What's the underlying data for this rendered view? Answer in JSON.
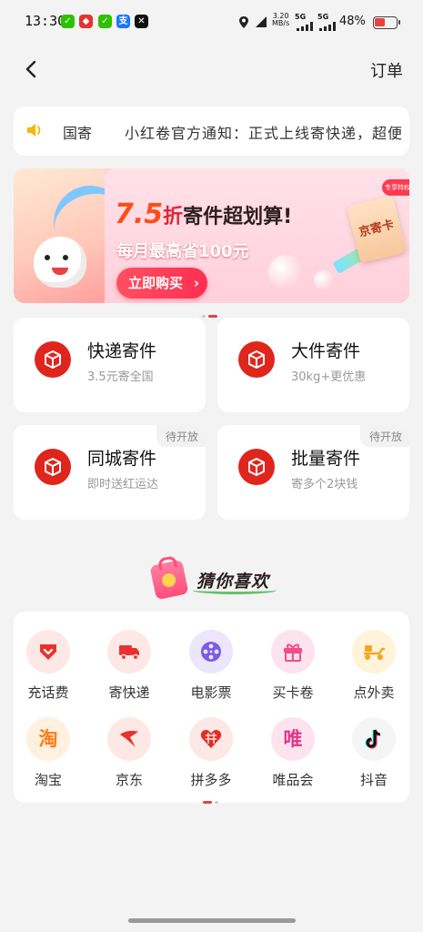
{
  "status_bar": {
    "time": "13:30",
    "speed_value": "3.20",
    "speed_unit": "MB/s",
    "net1": "5G",
    "net2": "5G",
    "battery": "48%",
    "battery_level": 0.48,
    "app_icons": [
      "wechat-icon",
      "app-red-icon",
      "wechat-icon",
      "alipay-icon",
      "capcut-icon"
    ]
  },
  "nav": {
    "back_icon": "chevron-left-icon",
    "orders_label": "订单"
  },
  "notice": {
    "icon": "speaker-icon",
    "tag": "国寄",
    "text": "小红卷官方通知：正式上线寄快递，超便"
  },
  "banner": {
    "discount": "7.5",
    "discount_unit": "折",
    "headline": "寄件超划算!",
    "subline": "每月最高省100元",
    "cta_label": "立即购买",
    "card_label": "京寄卡",
    "badge": "专享特权",
    "active_page": 1,
    "page_count": 2
  },
  "services": [
    {
      "title": "快递寄件",
      "subtitle": "3.5元寄全国",
      "badge": ""
    },
    {
      "title": "大件寄件",
      "subtitle": "30kg+更优惠",
      "badge": ""
    },
    {
      "title": "同城寄件",
      "subtitle": "即时送红运达",
      "badge": "待开放"
    },
    {
      "title": "批量寄件",
      "subtitle": "寄多个2块钱",
      "badge": "待开放"
    }
  ],
  "guess_section": {
    "title": "猜你喜欢"
  },
  "apps": [
    {
      "label": "充话费",
      "icon": "heart-tag-icon",
      "bg": "#fde8e6",
      "color": "#e8322f"
    },
    {
      "label": "寄快递",
      "icon": "truck-icon",
      "bg": "#fde8e6",
      "color": "#e8322f"
    },
    {
      "label": "电影票",
      "icon": "film-reel-icon",
      "bg": "#ebe6fb",
      "color": "#7a5ce6"
    },
    {
      "label": "买卡卷",
      "icon": "gift-icon",
      "bg": "#fde3ee",
      "color": "#ef4e8a"
    },
    {
      "label": "点外卖",
      "icon": "scooter-icon",
      "bg": "#fff3d9",
      "color": "#f5a623"
    },
    {
      "label": "淘宝",
      "icon": "taobao-icon",
      "glyph": "淘",
      "bg": "#fff0df",
      "color": "#ff7a1a"
    },
    {
      "label": "京东",
      "icon": "jd-icon",
      "bg": "#fde8e6",
      "color": "#e8322f"
    },
    {
      "label": "拼多多",
      "icon": "pinduoduo-icon",
      "bg": "#fde8e6",
      "color": "#e02e24"
    },
    {
      "label": "唯品会",
      "icon": "vipshop-icon",
      "glyph": "唯",
      "bg": "#fde3ee",
      "color": "#e0358a"
    },
    {
      "label": "抖音",
      "icon": "douyin-icon",
      "bg": "#f5f5f5",
      "color": "#111111"
    }
  ],
  "apps_pager": {
    "active_page": 1,
    "page_count": 2
  },
  "colors": {
    "accent": "#e0251c",
    "background": "#f3f3f3",
    "card": "#ffffff",
    "muted_text": "#999999"
  }
}
